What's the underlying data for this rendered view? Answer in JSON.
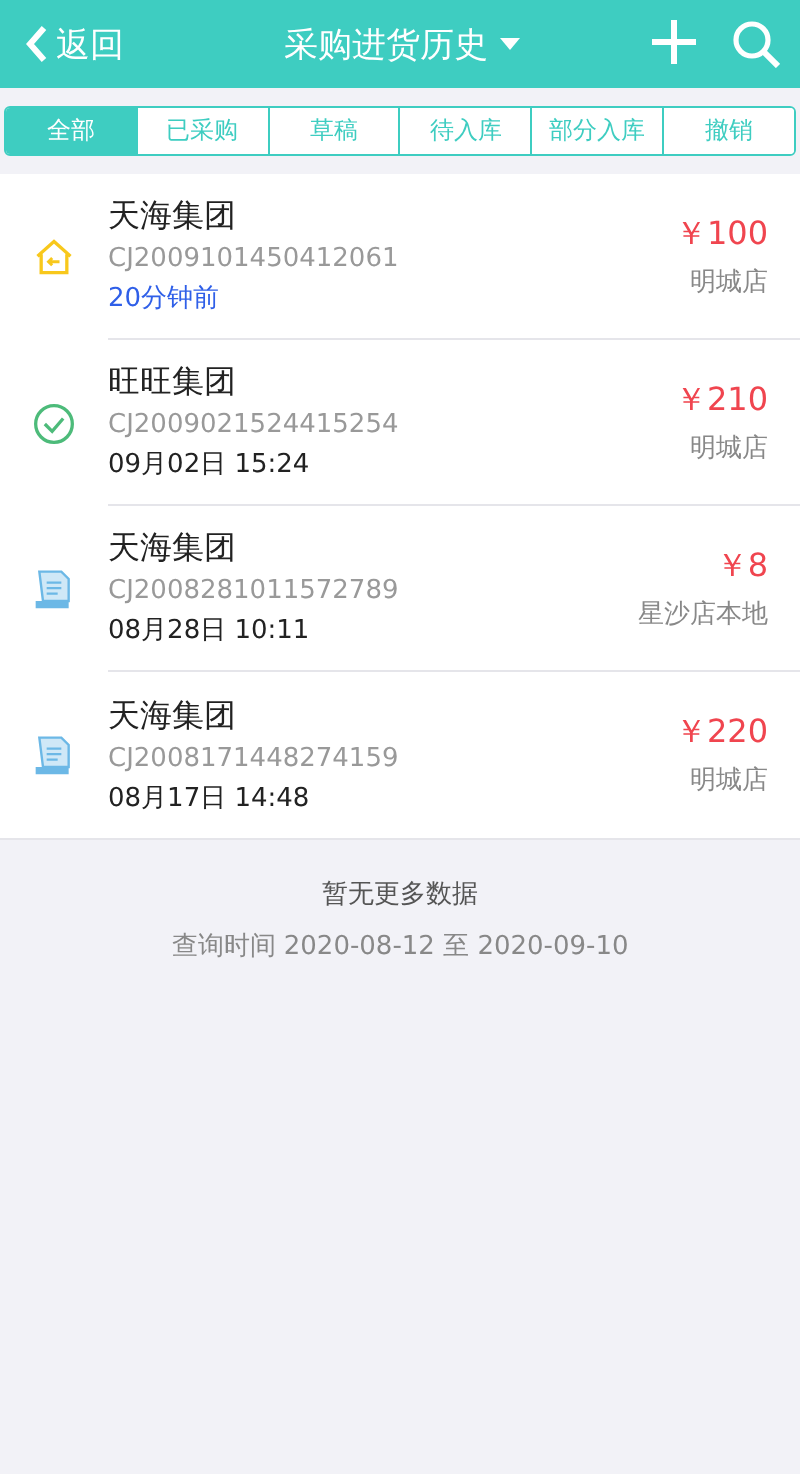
{
  "header": {
    "back": "返回",
    "title": "采购进货历史"
  },
  "tabs": [
    {
      "label": "全部",
      "selected": true
    },
    {
      "label": "已采购",
      "selected": false
    },
    {
      "label": "草稿",
      "selected": false
    },
    {
      "label": "待入库",
      "selected": false
    },
    {
      "label": "部分入库",
      "selected": false
    },
    {
      "label": "撤销",
      "selected": false
    }
  ],
  "orders": [
    {
      "kind": "inbound",
      "company": "天海集团",
      "code": "CJ2009101450412061",
      "time": "20分钟前",
      "recent": true,
      "amount": "￥100",
      "store": "明城店"
    },
    {
      "kind": "done",
      "company": "旺旺集团",
      "code": "CJ2009021524415254",
      "time": "09月02日 15:24",
      "recent": false,
      "amount": "￥210",
      "store": "明城店"
    },
    {
      "kind": "draft",
      "company": "天海集团",
      "code": "CJ2008281011572789",
      "time": "08月28日 10:11",
      "recent": false,
      "amount": "￥8",
      "store": "星沙店本地"
    },
    {
      "kind": "draft",
      "company": "天海集团",
      "code": "CJ2008171448274159",
      "time": "08月17日 14:48",
      "recent": false,
      "amount": "￥220",
      "store": "明城店"
    }
  ],
  "footer": {
    "end_note": "暂无更多数据",
    "range": "查询时间 2020-08-12 至 2020-09-10"
  }
}
